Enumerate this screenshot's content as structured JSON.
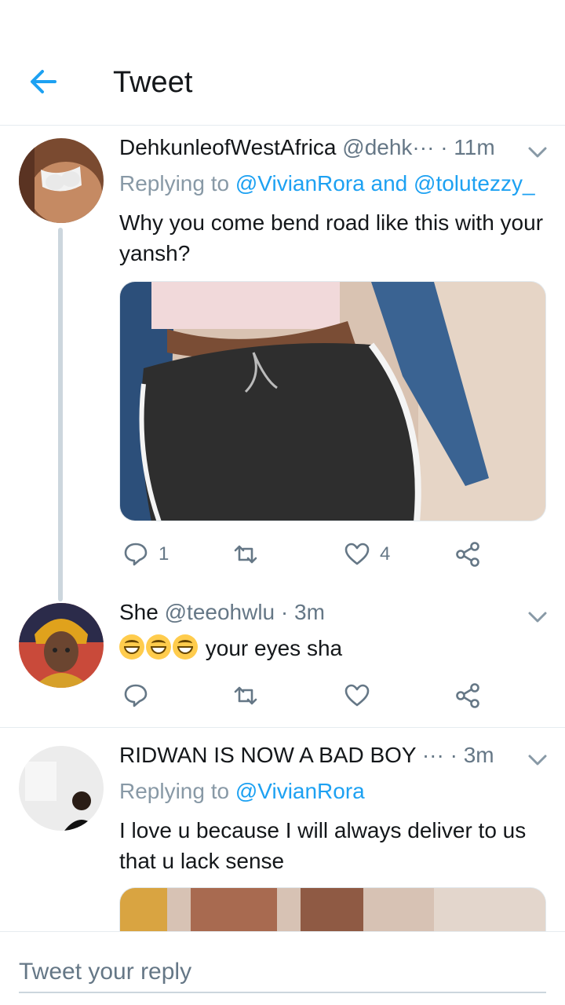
{
  "header": {
    "title": "Tweet",
    "back_icon": "arrow-left-icon",
    "accent": "#1da1f2"
  },
  "tweets": [
    {
      "name": "DehkunleofWestAfrica",
      "handle": "@dehk···",
      "sep": "·",
      "time": "11m",
      "replying_label": "Replying to",
      "replying_to_1": "@VivianRora",
      "replying_and": "and",
      "replying_to_2": "@tolutezzy_",
      "text": "Why you come bend road like this with your yansh?",
      "reply_count": "1",
      "retweet_count": "",
      "like_count": "4"
    },
    {
      "name": "She",
      "handle": "@teeohwlu",
      "sep": "·",
      "time": "3m",
      "text": "your eyes sha",
      "emoji": "grinning-face-emoji"
    },
    {
      "name": "RIDWAN IS NOW A BAD BOY",
      "handle": "···",
      "sep": "·",
      "time": "3m",
      "replying_label": "Replying to",
      "replying_to_1": "@VivianRora",
      "text": "I love u because I will always deliver to us that u lack sense"
    }
  ],
  "reply_bar": {
    "placeholder": "Tweet your reply"
  }
}
